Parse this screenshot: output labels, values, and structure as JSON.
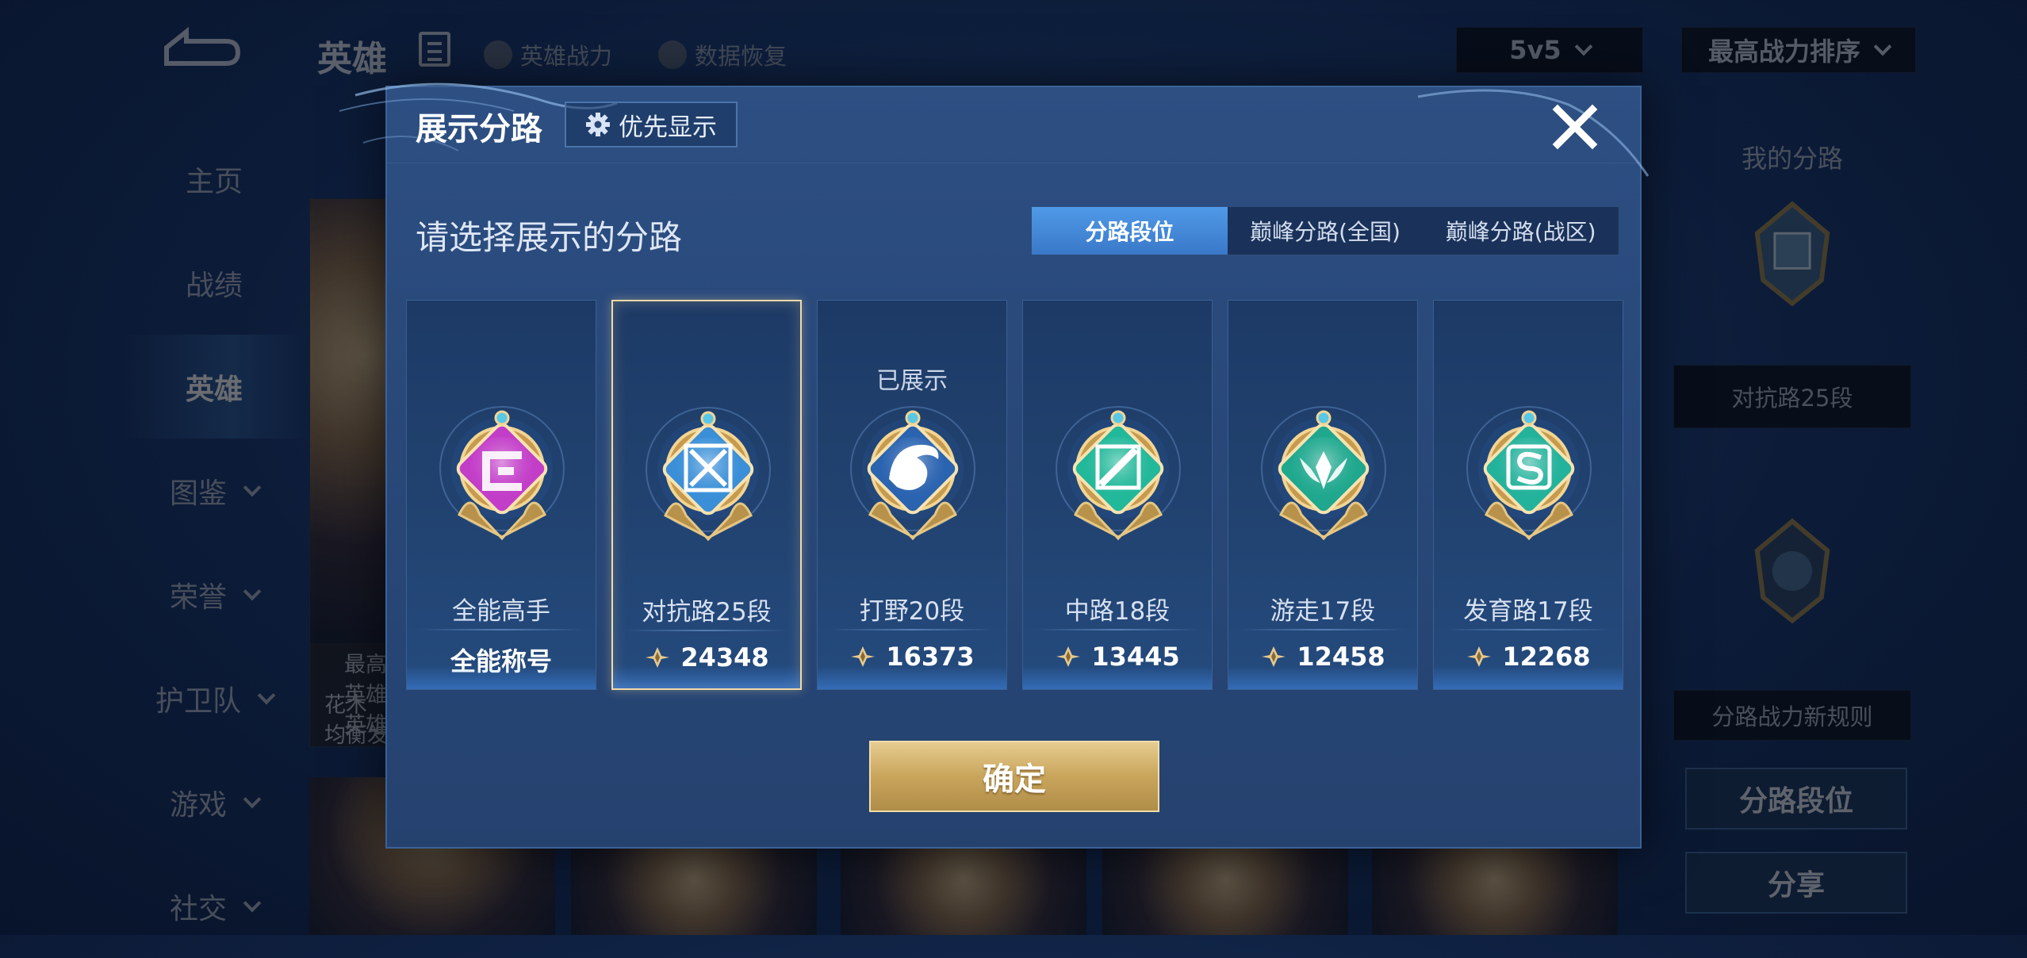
{
  "background": {
    "page_title": "英雄",
    "top_links": [
      "英雄战力",
      "数据恢复"
    ],
    "mode_select": "5v5",
    "sort_select": "最高战力排序",
    "nav": [
      {
        "label": "主页",
        "has_chevron": false
      },
      {
        "label": "战绩",
        "has_chevron": false
      },
      {
        "label": "英雄",
        "has_chevron": false,
        "active": true
      },
      {
        "label": "图鉴",
        "has_chevron": true
      },
      {
        "label": "荣誉",
        "has_chevron": true
      },
      {
        "label": "护卫队",
        "has_chevron": true
      },
      {
        "label": "游戏",
        "has_chevron": true
      },
      {
        "label": "社交",
        "has_chevron": true
      }
    ],
    "hero_card_text": [
      "花木",
      "均衡发"
    ],
    "hero_card_sub": [
      "最高",
      "英雄",
      "英雄"
    ],
    "right_panel": {
      "title": "我的分路",
      "rank_label": "对抗路25段",
      "rules_link": "分路战力新规则",
      "rank_button": "分路段位",
      "share_button": "分享"
    }
  },
  "modal": {
    "title": "展示分路",
    "priority_button": "优先显示",
    "subtitle": "请选择展示的分路",
    "tabs": [
      {
        "label": "分路段位",
        "active": true
      },
      {
        "label": "巅峰分路(全国)",
        "active": false
      },
      {
        "label": "巅峰分路(战区)",
        "active": false
      }
    ],
    "cards": [
      {
        "name": "全能高手",
        "power": "全能称号",
        "show_power_icon": false,
        "shown_label": "",
        "selected": false,
        "emblem": "allround-emblem-icon",
        "color": "#c23dc8"
      },
      {
        "name": "对抗路25段",
        "power": "24348",
        "show_power_icon": true,
        "shown_label": "",
        "selected": true,
        "emblem": "clash-lane-emblem-icon",
        "color": "#3a8fd8"
      },
      {
        "name": "打野20段",
        "power": "16373",
        "show_power_icon": true,
        "shown_label": "已展示",
        "selected": false,
        "emblem": "jungle-emblem-icon",
        "color": "#2a63b0"
      },
      {
        "name": "中路18段",
        "power": "13445",
        "show_power_icon": true,
        "shown_label": "",
        "selected": false,
        "emblem": "mid-lane-emblem-icon",
        "color": "#22b89a"
      },
      {
        "name": "游走17段",
        "power": "12458",
        "show_power_icon": true,
        "shown_label": "",
        "selected": false,
        "emblem": "roam-emblem-icon",
        "color": "#1fa88e"
      },
      {
        "name": "发育路17段",
        "power": "12268",
        "show_power_icon": true,
        "shown_label": "",
        "selected": false,
        "emblem": "farm-lane-emblem-icon",
        "color": "#23b29b"
      }
    ],
    "confirm_button": "确定"
  }
}
